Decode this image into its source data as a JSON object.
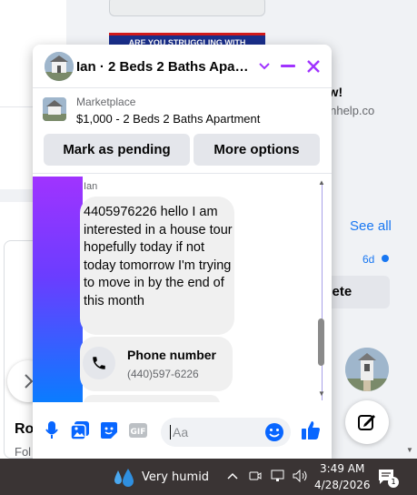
{
  "background": {
    "ad_banner_text": "ARE YOU STRUGGLING WITH",
    "ad_title_fragment": "ow!",
    "ad_url_fragment": "ionhelp.co",
    "see_all_label": "See all",
    "notification_time": "6d",
    "delete_button_fragment": "elete",
    "left_card_title_fragment": "Ro",
    "left_card_subtitle_fragment": "Fol"
  },
  "chat": {
    "title": "Ian · 2 Beds 2 Baths Apartment",
    "header_icons": [
      "chevron-down-icon",
      "minimize-icon",
      "close-icon"
    ],
    "accent_color": "#a033ff",
    "listing": {
      "category": "Marketplace",
      "title": "$1,000 - 2 Beds 2 Baths Apartment",
      "mark_pending_label": "Mark as pending",
      "more_options_label": "More options"
    },
    "messages": {
      "sender_name": "Ian",
      "text": "4405976226 hello I am interested in a house tour hopefully today if not today tomorrow I'm trying to move in by the end of this month",
      "phone_card": {
        "label": "Phone number",
        "value": "(440)597-6226"
      }
    },
    "composer": {
      "placeholder": "Aa",
      "icons": [
        "microphone-icon",
        "photo-icon",
        "sticker-icon",
        "gif-icon",
        "emoji-icon",
        "thumbs-up-icon"
      ],
      "gif_label": "GIF"
    }
  },
  "taskbar": {
    "weather": "Very humid",
    "time": "3:49 AM",
    "date": "4/28/2026",
    "notification_count": "1"
  }
}
